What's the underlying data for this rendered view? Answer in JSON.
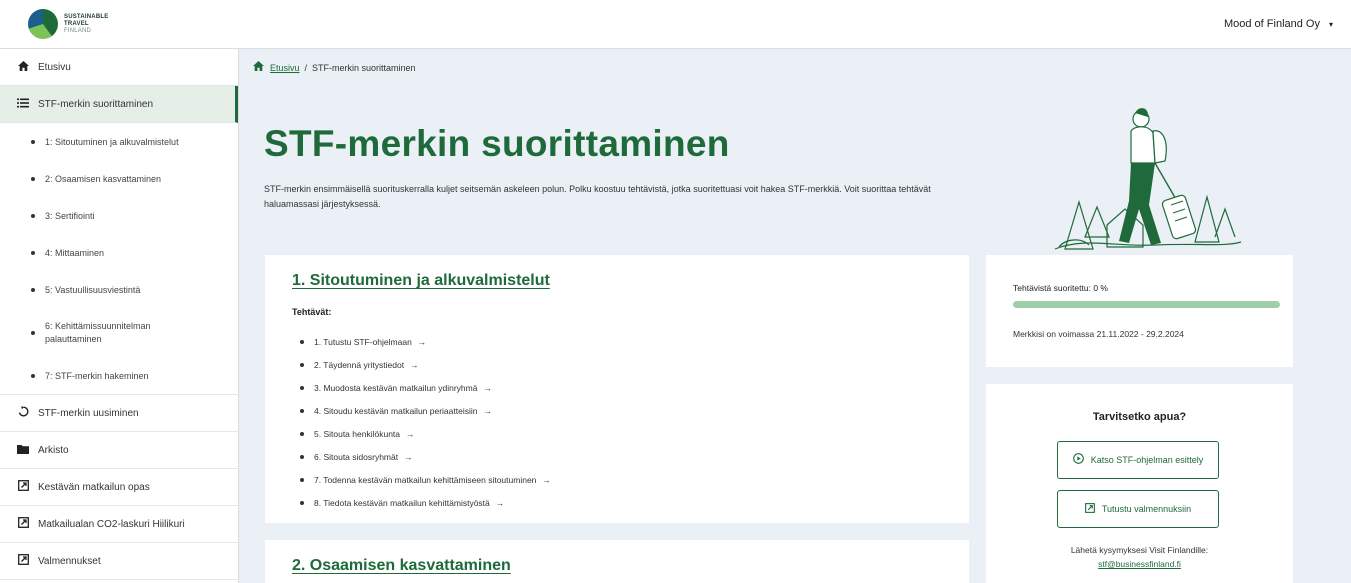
{
  "header": {
    "logo_lines": [
      "SUSTAINABLE",
      "TRAVEL",
      "FINLAND"
    ],
    "org_name": "Mood of Finland Oy",
    "caret": "▾"
  },
  "sidebar": {
    "items": [
      {
        "icon": "home-icon",
        "label": "Etusivu"
      },
      {
        "icon": "list-icon",
        "label": "STF-merkin suorittaminen",
        "active": true
      }
    ],
    "subitems": [
      "1: Sitoutuminen ja alkuvalmistelut",
      "2: Osaamisen kasvattaminen",
      "3: Sertifiointi",
      "4: Mittaaminen",
      "5: Vastuullisuusviestintä",
      "6: Kehittämissuunnitelman palauttaminen",
      "7: STF-merkin hakeminen"
    ],
    "bottom_items": [
      {
        "icon": "refresh-icon",
        "label": "STF-merkin uusiminen"
      },
      {
        "icon": "folder-icon",
        "label": "Arkisto"
      },
      {
        "icon": "external-link-icon",
        "label": "Kestävän matkailun opas"
      },
      {
        "icon": "external-link-icon",
        "label": "Matkailualan CO2-laskuri Hiilikuri"
      },
      {
        "icon": "external-link-icon",
        "label": "Valmennukset"
      }
    ]
  },
  "breadcrumb": {
    "home": "Etusivu",
    "separator": "/",
    "current": "STF-merkin suorittaminen"
  },
  "main": {
    "title": "STF-merkin suorittaminen",
    "intro": "STF-merkin ensimmäisellä suorituskerralla kuljet seitsemän askeleen polun. Polku koostuu tehtävistä, jotka suoritettuasi voit hakea STF-merkkiä. Voit suorittaa tehtävät haluamassasi järjestyksessä."
  },
  "step1": {
    "title": "1. Sitoutuminen ja alkuvalmistelut",
    "tasks_label": "Tehtävät:",
    "tasks": [
      "1. Tutustu STF-ohjelmaan",
      "2. Täydennä yritystiedot",
      "3. Muodosta kestävän matkailun ydinryhmä",
      "4. Sitoudu kestävän matkailun periaatteisiin",
      "5. Sitouta henkilökunta",
      "6. Sitouta sidosryhmät",
      "7. Todenna kestävän matkailun kehittämiseen sitoutuminen",
      "8. Tiedota kestävän matkailun kehittämistyöstä"
    ],
    "arrow": "→"
  },
  "step2": {
    "title": "2. Osaamisen kasvattaminen"
  },
  "progress": {
    "label": "Tehtävistä suoritettu: 0 %",
    "fraction": 0,
    "validity": "Merkkisi on voimassa 21.11.2022 - 29.2.2024"
  },
  "help": {
    "title": "Tarvitsetko apua?",
    "btn1": "Katso STF-ohjelman esittely",
    "btn2": "Tutustu valmennuksiin",
    "text": "Lähetä kysymyksesi Visit Finlandille:",
    "email": "stf@businessfinland.fi"
  },
  "colors": {
    "brand_green": "#1f6a3b",
    "progress_track": "#9fcfa9",
    "background": "#eaf0f5"
  }
}
